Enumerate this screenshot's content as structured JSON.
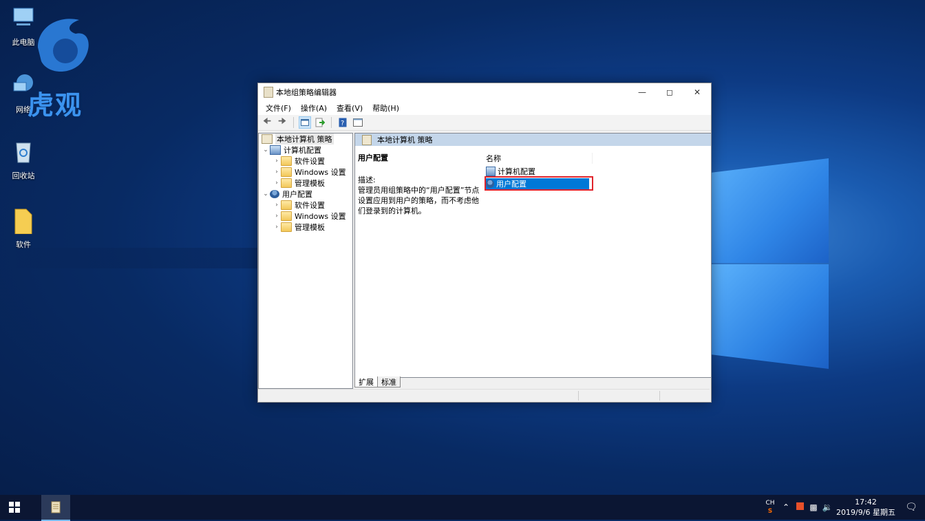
{
  "desktop": {
    "icons": [
      {
        "label": "此电脑",
        "icon": "this-pc-icon"
      },
      {
        "label": "网络",
        "icon": "network-icon"
      },
      {
        "label": "回收站",
        "icon": "recycle-bin-icon"
      },
      {
        "label": "软件",
        "icon": "folder-icon"
      }
    ],
    "watermark_text": "虎观"
  },
  "window": {
    "title": "本地组策略编辑器",
    "menu": [
      "文件(F)",
      "操作(A)",
      "查看(V)",
      "帮助(H)"
    ],
    "toolbar_icons": [
      "back-icon",
      "forward-icon",
      "show-hide-tree-icon",
      "export-list-icon",
      "help-icon",
      "properties-icon"
    ],
    "tree": {
      "root": "本地计算机 策略",
      "computer_config": {
        "label": "计算机配置",
        "children": [
          "软件设置",
          "Windows 设置",
          "管理模板"
        ]
      },
      "user_config": {
        "label": "用户配置",
        "children": [
          "软件设置",
          "Windows 设置",
          "管理模板"
        ]
      }
    },
    "right_pane": {
      "header": "本地计算机 策略",
      "desc_title": "用户配置",
      "desc_label": "描述:",
      "desc_text": "管理员用组策略中的“用户配置”节点设置应用到用户的策略，而不考虑他们登录到的计算机。",
      "column_name": "名称",
      "items": [
        "计算机配置",
        "用户配置"
      ],
      "selected_index": 1
    },
    "tabs": [
      "扩展",
      "标准"
    ]
  },
  "taskbar": {
    "ime": "CH",
    "clock_time": "17:42",
    "clock_date": "2019/9/6 星期五"
  },
  "colors": {
    "selection": "#0078d7",
    "highlight_box": "#e0232b",
    "taskbar": "#0b1633"
  }
}
